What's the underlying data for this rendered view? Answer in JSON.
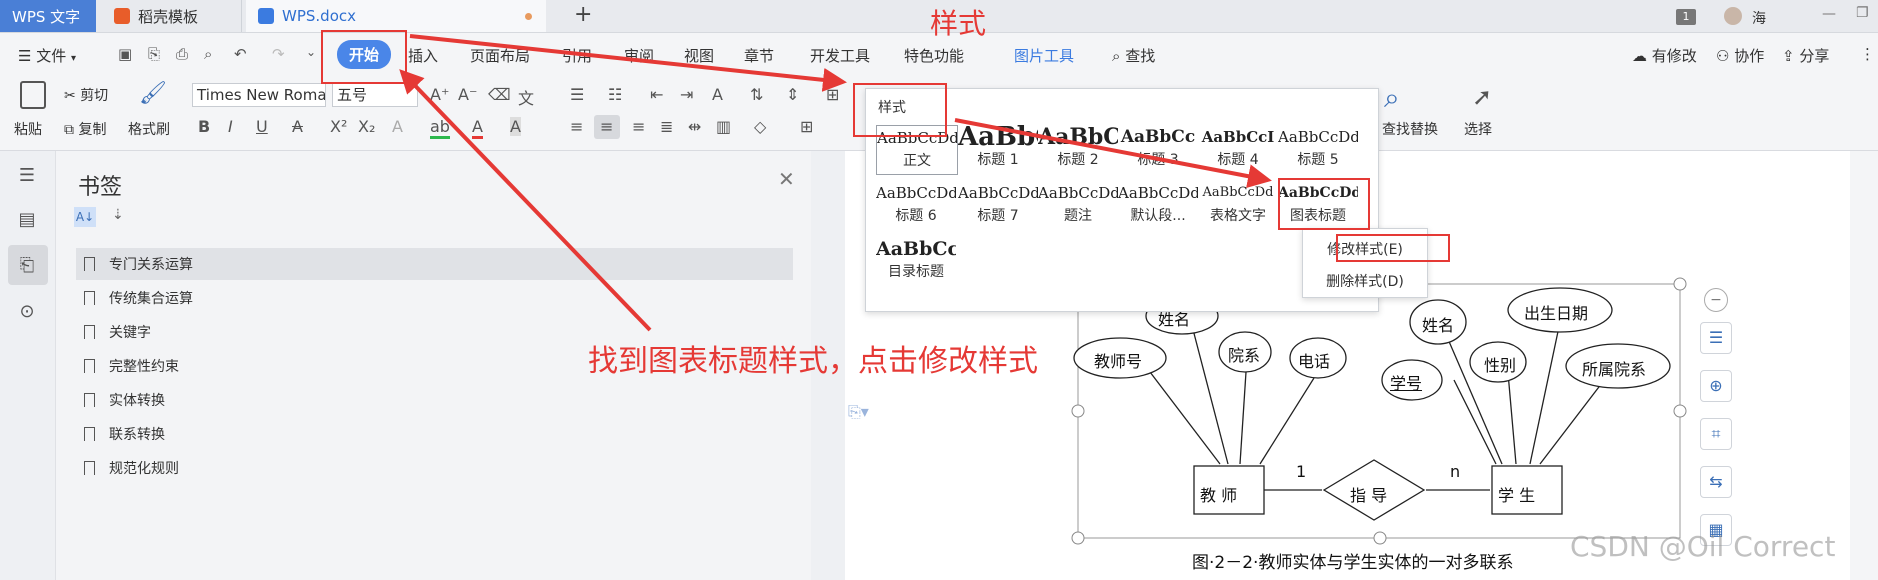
{
  "titlebar": {
    "app_tab": "WPS 文字",
    "tab2": "稻壳模板",
    "tab3": "WPS.docx",
    "new_tab": "+",
    "badge": "1",
    "user": "海"
  },
  "menubar": {
    "file": "文件",
    "items": [
      "开始",
      "插入",
      "页面布局",
      "引用",
      "审阅",
      "视图",
      "章节",
      "开发工具",
      "特色功能",
      "图片工具"
    ],
    "search": "查找",
    "modify": "有修改",
    "collab": "协作",
    "share": "分享"
  },
  "ribbon": {
    "paste": "粘贴",
    "cut": "剪切",
    "copy": "复制",
    "format_painter": "格式刷",
    "font_name": "Times New Roma",
    "font_size": "五号",
    "find_replace": "查找替换",
    "select": "选择"
  },
  "style_popup": {
    "title": "样式",
    "styles": [
      {
        "preview": "AaBbCcDd",
        "name": "正文"
      },
      {
        "preview": "AaBbC",
        "name": "标题 1"
      },
      {
        "preview": "AaBbC",
        "name": "标题 2"
      },
      {
        "preview": "AaBbCc",
        "name": "标题 3"
      },
      {
        "preview": "AaBbCcI",
        "name": "标题 4"
      },
      {
        "preview": "AaBbCcDd",
        "name": "标题 5"
      },
      {
        "preview": "AaBbCcDd",
        "name": "标题 6"
      },
      {
        "preview": "AaBbCcDd",
        "name": "标题 7"
      },
      {
        "preview": "AaBbCcDd",
        "name": "题注"
      },
      {
        "preview": "AaBbCcDd",
        "name": "默认段..."
      },
      {
        "preview": "AaBbCcDd",
        "name": "表格文字"
      },
      {
        "preview": "AaBbCcDd",
        "name": "图表标题"
      },
      {
        "preview": "AaBbCc",
        "name": "目录标题"
      }
    ]
  },
  "context_menu": {
    "modify": "修改样式(E)",
    "delete": "删除样式(D)"
  },
  "bookmarks": {
    "title": "书签",
    "items": [
      "专门关系运算",
      "传统集合运算",
      "关键字",
      "完整性约束",
      "实体转换",
      "联系转换",
      "规范化规则"
    ]
  },
  "annotations": {
    "style_label": "样式",
    "instruction": "找到图表标题样式，点击修改样式"
  },
  "er_diagram": {
    "teacher_attrs": [
      "姓名",
      "教师号",
      "院系",
      "电话"
    ],
    "student_attrs": [
      "姓名",
      "出生日期",
      "学号",
      "性别",
      "所属院系"
    ],
    "teacher": "教 师",
    "relation": "指 导",
    "student": "学 生",
    "card1": "1",
    "cardn": "n",
    "caption": "图·2－2·教师实体与学生实体的一对多联系"
  },
  "watermark": "CSDN @Oil Correct",
  "colors": {
    "accent": "#4a86e8",
    "annotation_red": "#e53935"
  }
}
